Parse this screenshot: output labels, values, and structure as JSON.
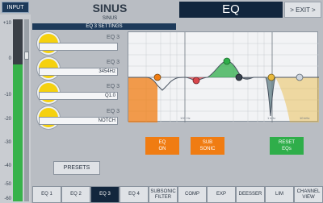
{
  "input_button": "INPUT",
  "meter": {
    "ticks": [
      "+10",
      "0",
      "-10",
      "-20",
      "-30",
      "-40",
      "-50",
      "-60"
    ]
  },
  "header": {
    "title": "SINUS",
    "subtitle": "SINUS",
    "section": "EQ 3 SETTINGS",
    "tab": "EQ",
    "exit": "> EXIT >"
  },
  "rows": [
    {
      "label": "EQ 3",
      "value": ""
    },
    {
      "label": "EQ 3",
      "value": "3454Hz"
    },
    {
      "label": "EQ 3",
      "value": "Q1.0"
    },
    {
      "label": "EQ 3",
      "value": "NOTCH"
    }
  ],
  "graph": {
    "freq_labels": [
      "100 Hz",
      "1 kHz",
      "10 kHz"
    ],
    "colors": {
      "low": "#f07c12",
      "eq2": "#d9464b",
      "eq3": "#2fae4a",
      "eq4": "#37414e",
      "high_shelf": "#e8b93c",
      "notch": "#2f6aa3"
    }
  },
  "buttons": {
    "eq_on": "EQ\nON",
    "sub_sonic": "SUB\nSONIC",
    "reset": "RESET\nEQs",
    "presets": "PRESETS"
  },
  "tabs": [
    {
      "label": "EQ 1",
      "active": false
    },
    {
      "label": "EQ 2",
      "active": false
    },
    {
      "label": "EQ 3",
      "active": true
    },
    {
      "label": "EQ 4",
      "active": false
    },
    {
      "label": "SUBSONIC\nFILTER",
      "active": false
    },
    {
      "label": "COMP",
      "active": false
    },
    {
      "label": "EXP",
      "active": false
    },
    {
      "label": "DEESSER",
      "active": false
    },
    {
      "label": "LIM",
      "active": false
    },
    {
      "label": "CHANNEL\nVIEW",
      "active": false
    }
  ]
}
